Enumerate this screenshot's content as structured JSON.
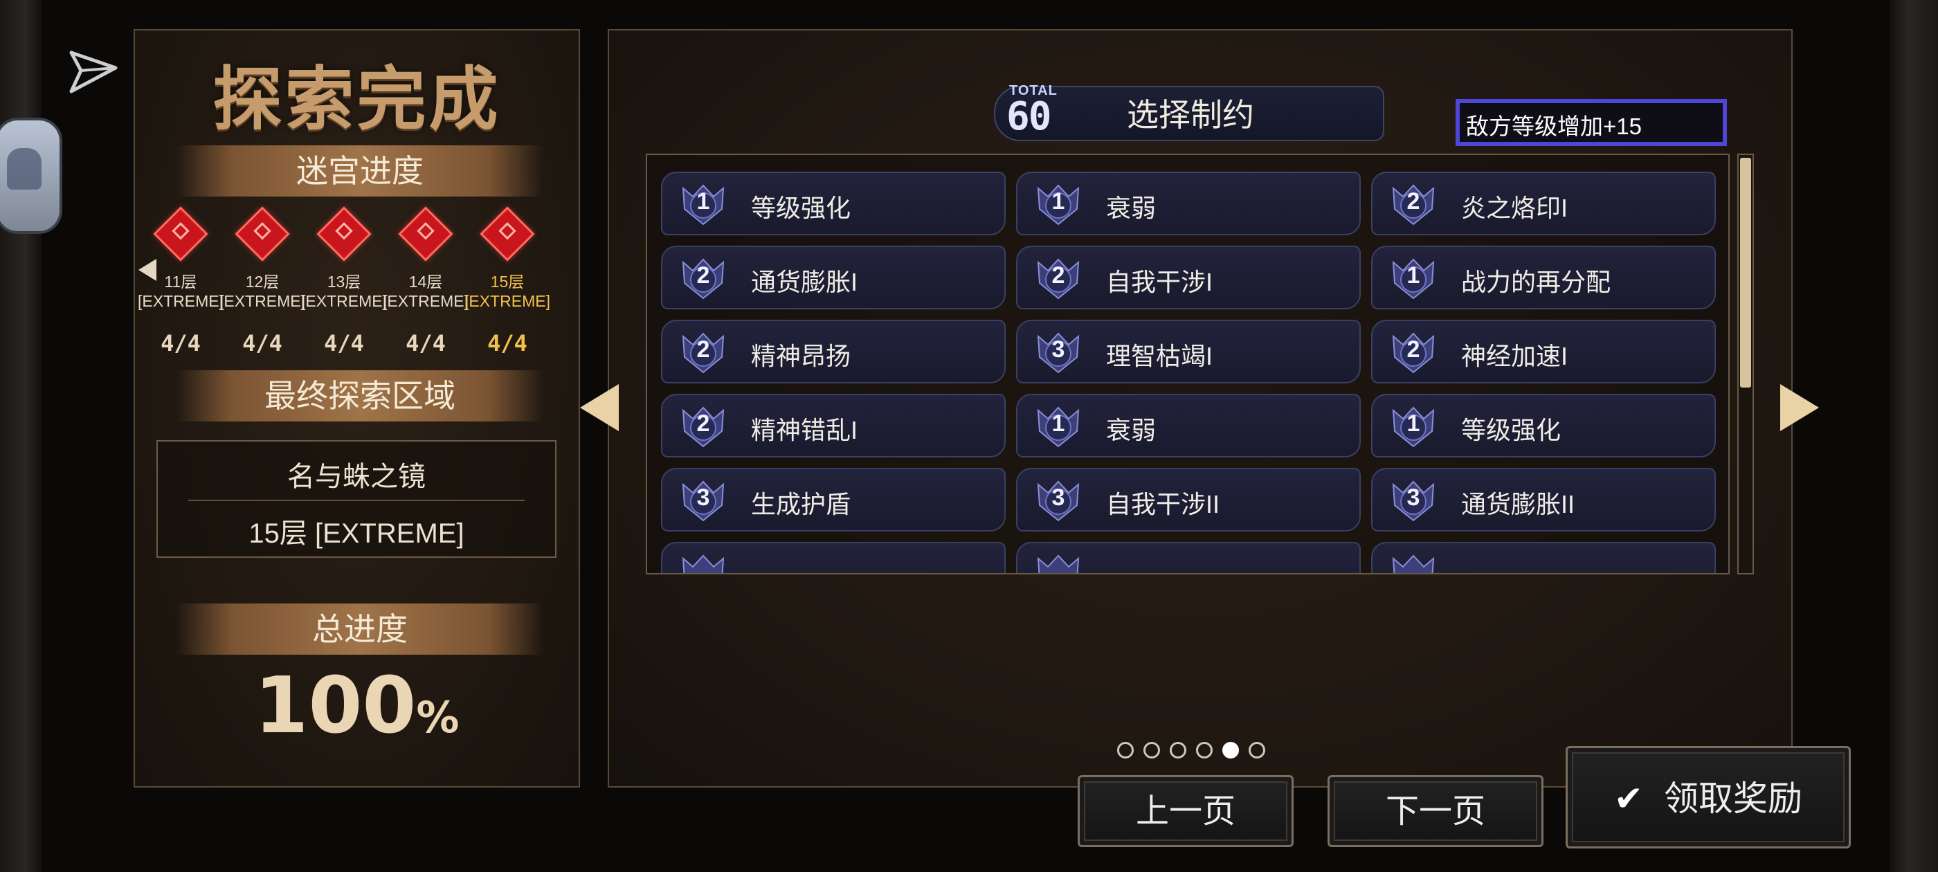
{
  "left_panel": {
    "title": "探索完成",
    "progress_heading": "迷宫进度",
    "floors": [
      {
        "name": "11层",
        "level": "[EXTREME]",
        "count": "4/4",
        "active": false
      },
      {
        "name": "12层",
        "level": "[EXTREME]",
        "count": "4/4",
        "active": false
      },
      {
        "name": "13层",
        "level": "[EXTREME]",
        "count": "4/4",
        "active": false
      },
      {
        "name": "14层",
        "level": "[EXTREME]",
        "count": "4/4",
        "active": false
      },
      {
        "name": "15层",
        "level": "[EXTREME]",
        "count": "4/4",
        "active": true
      }
    ],
    "final_area_heading": "最终探索区域",
    "final_area_name": "名与蛛之镜",
    "final_area_floor": "15层 [EXTREME]",
    "total_progress_heading": "总进度",
    "total_progress_value": "100",
    "total_progress_unit": "%"
  },
  "right_panel": {
    "total_label": "TOTAL",
    "total_value": "60",
    "title": "选择制约",
    "limit_text": "敌方等级增加+15",
    "items": [
      {
        "level": "1",
        "label": "等级强化"
      },
      {
        "level": "1",
        "label": "衰弱"
      },
      {
        "level": "2",
        "label": "炎之烙印I"
      },
      {
        "level": "2",
        "label": "通货膨胀I"
      },
      {
        "level": "2",
        "label": "自我干涉I"
      },
      {
        "level": "1",
        "label": "战力的再分配"
      },
      {
        "level": "2",
        "label": "精神昂扬"
      },
      {
        "level": "3",
        "label": "理智枯竭I"
      },
      {
        "level": "2",
        "label": "神经加速I"
      },
      {
        "level": "2",
        "label": "精神错乱I"
      },
      {
        "level": "1",
        "label": "衰弱"
      },
      {
        "level": "1",
        "label": "等级强化"
      },
      {
        "level": "3",
        "label": "生成护盾"
      },
      {
        "level": "3",
        "label": "自我干涉II"
      },
      {
        "level": "3",
        "label": "通货膨胀II"
      }
    ],
    "page_dots": {
      "total": 6,
      "current_index": 4
    }
  },
  "buttons": {
    "prev_label": "上一页",
    "next_label": "下一页",
    "claim_label": "领取奖励"
  },
  "colors": {
    "accent_gold": "#f3c24a",
    "limit_border": "#4e45d9",
    "title_tan": "#c79c6d"
  }
}
